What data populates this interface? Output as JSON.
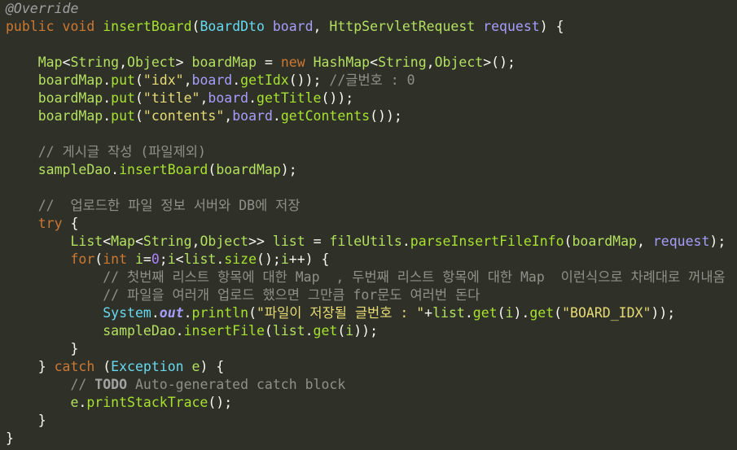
{
  "editor": {
    "lines": [
      [
        {
          "t": "@Override",
          "c": "anno"
        }
      ],
      [
        {
          "t": "public",
          "c": "kw"
        },
        {
          "t": " ",
          "c": "plain"
        },
        {
          "t": "void",
          "c": "kw"
        },
        {
          "t": " ",
          "c": "plain"
        },
        {
          "t": "insertBoard",
          "c": "fn"
        },
        {
          "t": "(",
          "c": "plain"
        },
        {
          "t": "BoardDto",
          "c": "type"
        },
        {
          "t": " ",
          "c": "plain"
        },
        {
          "t": "board",
          "c": "var"
        },
        {
          "t": ", ",
          "c": "plain"
        },
        {
          "t": "HttpServletRequest",
          "c": "gen"
        },
        {
          "t": " ",
          "c": "plain"
        },
        {
          "t": "request",
          "c": "var"
        },
        {
          "t": ") {",
          "c": "plain"
        }
      ],
      [],
      [
        {
          "t": "    ",
          "c": "plain"
        },
        {
          "t": "Map",
          "c": "gen"
        },
        {
          "t": "<",
          "c": "plain"
        },
        {
          "t": "String",
          "c": "gen"
        },
        {
          "t": ",",
          "c": "plain"
        },
        {
          "t": "Object",
          "c": "gen"
        },
        {
          "t": ">",
          "c": "plain"
        },
        {
          "t": " ",
          "c": "plain"
        },
        {
          "t": "boardMap",
          "c": "gen"
        },
        {
          "t": " = ",
          "c": "plain"
        },
        {
          "t": "new",
          "c": "kw"
        },
        {
          "t": " ",
          "c": "plain"
        },
        {
          "t": "HashMap",
          "c": "gen"
        },
        {
          "t": "<",
          "c": "plain"
        },
        {
          "t": "String",
          "c": "gen"
        },
        {
          "t": ",",
          "c": "plain"
        },
        {
          "t": "Object",
          "c": "gen"
        },
        {
          "t": ">();",
          "c": "plain"
        }
      ],
      [
        {
          "t": "    ",
          "c": "plain"
        },
        {
          "t": "boardMap",
          "c": "gen"
        },
        {
          "t": ".",
          "c": "plain"
        },
        {
          "t": "put",
          "c": "fn"
        },
        {
          "t": "(",
          "c": "plain"
        },
        {
          "t": "\"idx\"",
          "c": "str"
        },
        {
          "t": ",",
          "c": "plain"
        },
        {
          "t": "board",
          "c": "var"
        },
        {
          "t": ".",
          "c": "plain"
        },
        {
          "t": "getIdx",
          "c": "fn"
        },
        {
          "t": "()); ",
          "c": "plain"
        },
        {
          "t": "//글번호 : 0",
          "c": "com"
        }
      ],
      [
        {
          "t": "    ",
          "c": "plain"
        },
        {
          "t": "boardMap",
          "c": "gen"
        },
        {
          "t": ".",
          "c": "plain"
        },
        {
          "t": "put",
          "c": "fn"
        },
        {
          "t": "(",
          "c": "plain"
        },
        {
          "t": "\"title\"",
          "c": "str"
        },
        {
          "t": ",",
          "c": "plain"
        },
        {
          "t": "board",
          "c": "var"
        },
        {
          "t": ".",
          "c": "plain"
        },
        {
          "t": "getTitle",
          "c": "fn"
        },
        {
          "t": "());",
          "c": "plain"
        }
      ],
      [
        {
          "t": "    ",
          "c": "plain"
        },
        {
          "t": "boardMap",
          "c": "gen"
        },
        {
          "t": ".",
          "c": "plain"
        },
        {
          "t": "put",
          "c": "fn"
        },
        {
          "t": "(",
          "c": "plain"
        },
        {
          "t": "\"contents\"",
          "c": "str"
        },
        {
          "t": ",",
          "c": "plain"
        },
        {
          "t": "board",
          "c": "var"
        },
        {
          "t": ".",
          "c": "plain"
        },
        {
          "t": "getContents",
          "c": "fn"
        },
        {
          "t": "());",
          "c": "plain"
        }
      ],
      [],
      [
        {
          "t": "    ",
          "c": "plain"
        },
        {
          "t": "// 게시글 작성 (파일제외)",
          "c": "com"
        }
      ],
      [
        {
          "t": "    ",
          "c": "plain"
        },
        {
          "t": "sampleDao",
          "c": "gen"
        },
        {
          "t": ".",
          "c": "plain"
        },
        {
          "t": "insertBoard",
          "c": "fn"
        },
        {
          "t": "(",
          "c": "plain"
        },
        {
          "t": "boardMap",
          "c": "gen"
        },
        {
          "t": ");",
          "c": "plain"
        }
      ],
      [],
      [
        {
          "t": "    ",
          "c": "plain"
        },
        {
          "t": "//  업로드한 파일 정보 서버와 DB에 저장",
          "c": "com"
        }
      ],
      [
        {
          "t": "    ",
          "c": "plain"
        },
        {
          "t": "try",
          "c": "kw"
        },
        {
          "t": " {",
          "c": "plain"
        }
      ],
      [
        {
          "t": "        ",
          "c": "plain"
        },
        {
          "t": "List",
          "c": "gen"
        },
        {
          "t": "<",
          "c": "plain"
        },
        {
          "t": "Map",
          "c": "gen"
        },
        {
          "t": "<",
          "c": "plain"
        },
        {
          "t": "String",
          "c": "gen"
        },
        {
          "t": ",",
          "c": "plain"
        },
        {
          "t": "Object",
          "c": "gen"
        },
        {
          "t": ">> ",
          "c": "plain"
        },
        {
          "t": "list",
          "c": "gen"
        },
        {
          "t": " = ",
          "c": "plain"
        },
        {
          "t": "fileUtils",
          "c": "gen"
        },
        {
          "t": ".",
          "c": "plain"
        },
        {
          "t": "parseInsertFileInfo",
          "c": "fn"
        },
        {
          "t": "(",
          "c": "plain"
        },
        {
          "t": "boardMap",
          "c": "gen"
        },
        {
          "t": ", ",
          "c": "plain"
        },
        {
          "t": "request",
          "c": "var"
        },
        {
          "t": ");",
          "c": "plain"
        }
      ],
      [
        {
          "t": "        ",
          "c": "plain"
        },
        {
          "t": "for",
          "c": "kw"
        },
        {
          "t": "(",
          "c": "plain"
        },
        {
          "t": "int",
          "c": "kw"
        },
        {
          "t": " ",
          "c": "plain"
        },
        {
          "t": "i",
          "c": "gen"
        },
        {
          "t": "=",
          "c": "plain"
        },
        {
          "t": "0",
          "c": "num"
        },
        {
          "t": ";",
          "c": "plain"
        },
        {
          "t": "i",
          "c": "gen"
        },
        {
          "t": "<",
          "c": "plain"
        },
        {
          "t": "list",
          "c": "gen"
        },
        {
          "t": ".",
          "c": "plain"
        },
        {
          "t": "size",
          "c": "fn"
        },
        {
          "t": "();",
          "c": "plain"
        },
        {
          "t": "i",
          "c": "gen"
        },
        {
          "t": "++) {",
          "c": "plain"
        }
      ],
      [
        {
          "t": "            ",
          "c": "plain"
        },
        {
          "t": "// 첫번째 리스트 항목에 대한 Map  , 두번째 리스트 항목에 대한 Map  이런식으로 차례대로 꺼내옴",
          "c": "com"
        }
      ],
      [
        {
          "t": "            ",
          "c": "plain"
        },
        {
          "t": "// 파일을 여러개 업로드 했으면 그만큼 for문도 여러번 돈다",
          "c": "com"
        }
      ],
      [
        {
          "t": "            ",
          "c": "plain"
        },
        {
          "t": "System",
          "c": "type"
        },
        {
          "t": ".",
          "c": "plain"
        },
        {
          "t": "out",
          "c": "static"
        },
        {
          "t": ".",
          "c": "plain"
        },
        {
          "t": "println",
          "c": "fn"
        },
        {
          "t": "(",
          "c": "plain"
        },
        {
          "t": "\"파일이 저장될 글번호 : \"",
          "c": "str"
        },
        {
          "t": "+",
          "c": "plain"
        },
        {
          "t": "list",
          "c": "gen"
        },
        {
          "t": ".",
          "c": "plain"
        },
        {
          "t": "get",
          "c": "fn"
        },
        {
          "t": "(",
          "c": "plain"
        },
        {
          "t": "i",
          "c": "gen"
        },
        {
          "t": ").",
          "c": "plain"
        },
        {
          "t": "get",
          "c": "fn"
        },
        {
          "t": "(",
          "c": "plain"
        },
        {
          "t": "\"BOARD_IDX\"",
          "c": "str"
        },
        {
          "t": "));",
          "c": "plain"
        }
      ],
      [
        {
          "t": "            ",
          "c": "plain"
        },
        {
          "t": "sampleDao",
          "c": "gen"
        },
        {
          "t": ".",
          "c": "plain"
        },
        {
          "t": "insertFile",
          "c": "fn"
        },
        {
          "t": "(",
          "c": "plain"
        },
        {
          "t": "list",
          "c": "gen"
        },
        {
          "t": ".",
          "c": "plain"
        },
        {
          "t": "get",
          "c": "fn"
        },
        {
          "t": "(",
          "c": "plain"
        },
        {
          "t": "i",
          "c": "gen"
        },
        {
          "t": "));",
          "c": "plain"
        }
      ],
      [
        {
          "t": "        }",
          "c": "plain"
        }
      ],
      [
        {
          "t": "    } ",
          "c": "plain"
        },
        {
          "t": "catch",
          "c": "kw"
        },
        {
          "t": " (",
          "c": "plain"
        },
        {
          "t": "Exception",
          "c": "type"
        },
        {
          "t": " ",
          "c": "plain"
        },
        {
          "t": "e",
          "c": "gen"
        },
        {
          "t": ") {",
          "c": "plain"
        }
      ],
      [
        {
          "t": "        ",
          "c": "plain"
        },
        {
          "t": "// ",
          "c": "com"
        },
        {
          "t": "TODO",
          "c": "todo"
        },
        {
          "t": " Auto-generated catch block",
          "c": "com"
        }
      ],
      [
        {
          "t": "        ",
          "c": "plain"
        },
        {
          "t": "e",
          "c": "gen"
        },
        {
          "t": ".",
          "c": "plain"
        },
        {
          "t": "printStackTrace",
          "c": "fn"
        },
        {
          "t": "();",
          "c": "plain"
        }
      ],
      [
        {
          "t": "    }",
          "c": "plain"
        }
      ],
      [
        {
          "t": "}",
          "c": "plain"
        }
      ]
    ]
  }
}
